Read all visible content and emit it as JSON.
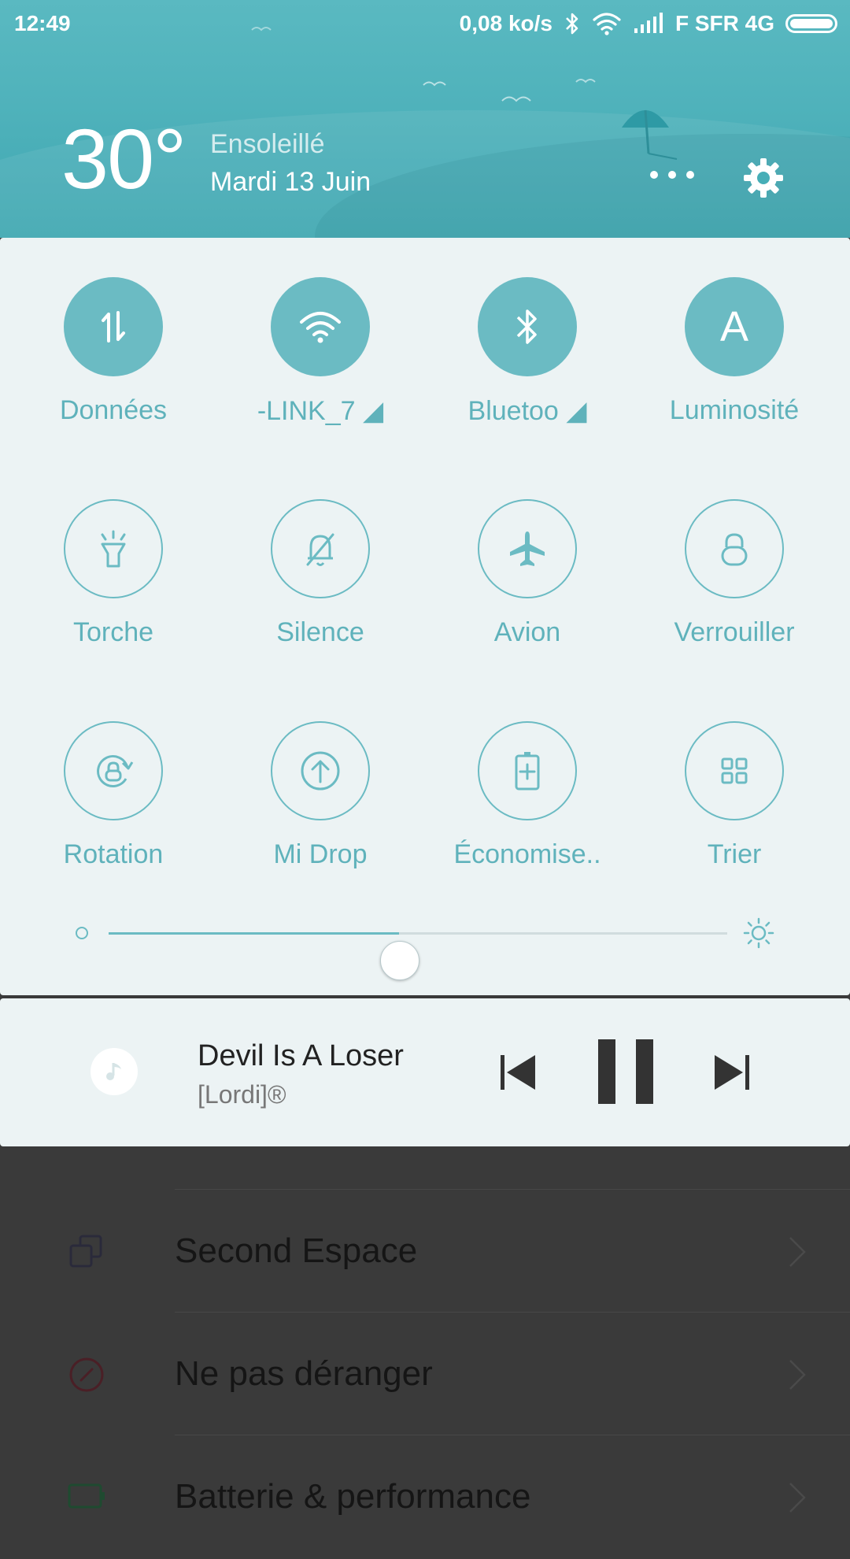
{
  "status_bar": {
    "time": "12:49",
    "net_speed": "0,08 ko/s",
    "carrier": "F SFR 4G",
    "icons": [
      "bluetooth-icon",
      "wifi-icon",
      "signal-icon",
      "battery-icon"
    ]
  },
  "weather": {
    "temperature": "30°",
    "condition": "Ensoleillé",
    "date": "Mardi 13 Juin"
  },
  "toggles": [
    {
      "label": "Données",
      "icon": "data-icon",
      "active": true
    },
    {
      "label": "-LINK_7",
      "icon": "wifi-icon",
      "active": true
    },
    {
      "label": "Bluetoo",
      "icon": "bluetooth-icon",
      "active": true
    },
    {
      "label": "Luminosité",
      "icon": "auto-brightness-icon",
      "active": true
    },
    {
      "label": "Torche",
      "icon": "flashlight-icon",
      "active": false
    },
    {
      "label": "Silence",
      "icon": "silent-icon",
      "active": false
    },
    {
      "label": "Avion",
      "icon": "airplane-icon",
      "active": false
    },
    {
      "label": "Verrouiller",
      "icon": "lock-icon",
      "active": false
    },
    {
      "label": "Rotation",
      "icon": "rotation-lock-icon",
      "active": false
    },
    {
      "label": "Mi Drop",
      "icon": "mi-drop-icon",
      "active": false
    },
    {
      "label": "Économise..",
      "icon": "battery-saver-icon",
      "active": false
    },
    {
      "label": "Trier",
      "icon": "grid-icon",
      "active": false
    }
  ],
  "brightness": {
    "level_percent": 47
  },
  "media": {
    "title": "Devil Is A Loser",
    "artist": "[Lordi]®"
  },
  "settings_list": [
    {
      "label": "Second Espace",
      "icon": "second-space-icon"
    },
    {
      "label": "Ne pas déranger",
      "icon": "do-not-disturb-icon"
    },
    {
      "label": "Batterie & performance",
      "icon": "battery-performance-icon"
    }
  ],
  "colors": {
    "accent": "#6bbbc3",
    "header": "#4fb2bb",
    "panel": "#ecf3f4"
  }
}
